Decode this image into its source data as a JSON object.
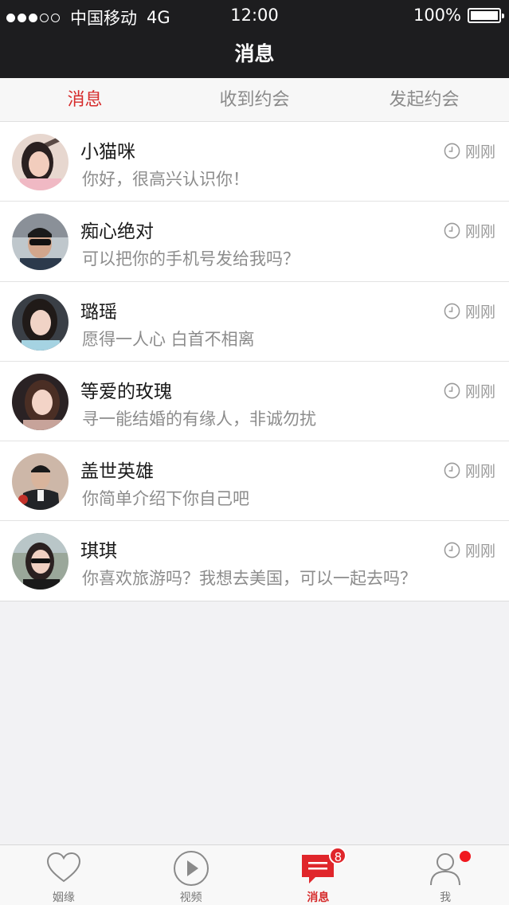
{
  "status_bar": {
    "carrier": "中国移动",
    "network": "4G",
    "time": "12:00",
    "battery": "100%"
  },
  "nav": {
    "title": "消息"
  },
  "tabs": [
    {
      "label": "消息",
      "active": true
    },
    {
      "label": "收到约会",
      "active": false
    },
    {
      "label": "发起约会",
      "active": false
    }
  ],
  "messages": [
    {
      "name": "小猫咪",
      "text": "你好，很高兴认识你！",
      "time": "刚刚"
    },
    {
      "name": "痴心绝对",
      "text": "可以把你的手机号发给我吗？",
      "time": "刚刚"
    },
    {
      "name": "璐瑶",
      "text": "愿得一人心 白首不相离",
      "time": "刚刚"
    },
    {
      "name": "等爱的玫瑰",
      "text": "寻一能结婚的有缘人，非诚勿扰",
      "time": "刚刚"
    },
    {
      "name": "盖世英雄",
      "text": "你简单介绍下你自己吧",
      "time": "刚刚"
    },
    {
      "name": "琪琪",
      "text": "你喜欢旅游吗？我想去美国，可以一起去吗？",
      "time": "刚刚"
    }
  ],
  "tabbar": [
    {
      "label": "姻缘",
      "icon": "heart-icon"
    },
    {
      "label": "视频",
      "icon": "play-icon"
    },
    {
      "label": "消息",
      "icon": "message-icon",
      "badge": "8",
      "active": true
    },
    {
      "label": "我",
      "icon": "profile-icon",
      "dot": true
    }
  ],
  "colors": {
    "accent": "#d62b2b",
    "header": "#1d1d1f"
  }
}
